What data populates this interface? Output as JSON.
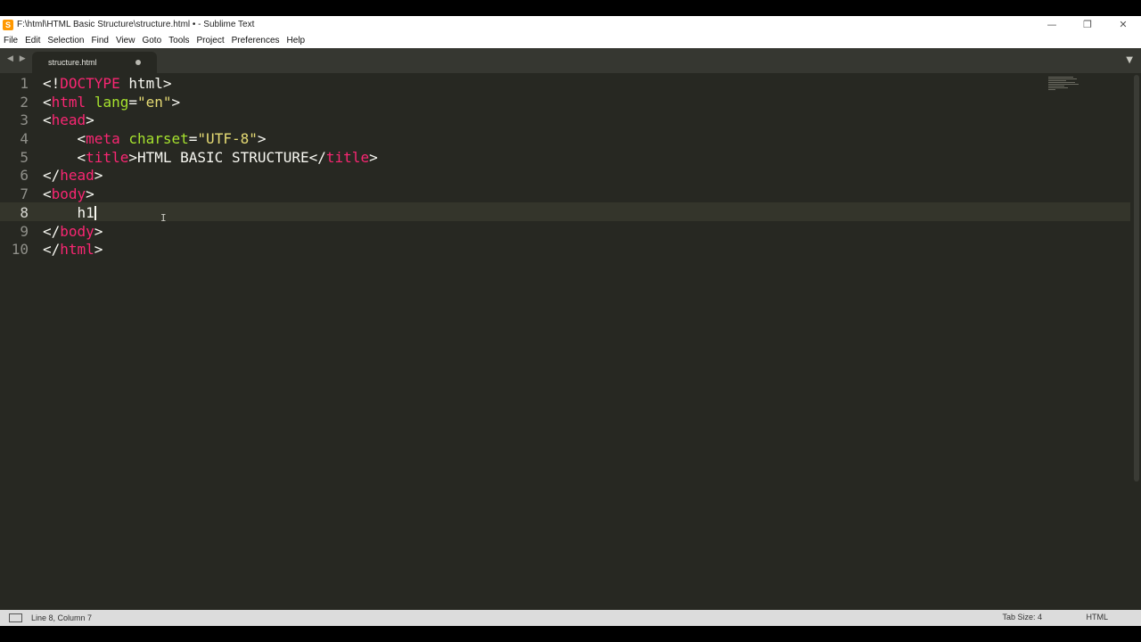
{
  "window": {
    "title": "F:\\html\\HTML Basic Structure\\structure.html • - Sublime Text",
    "controls": {
      "minimize": "—",
      "restore": "❐",
      "close": "✕"
    }
  },
  "menu": {
    "items": [
      "File",
      "Edit",
      "Selection",
      "Find",
      "View",
      "Goto",
      "Tools",
      "Project",
      "Preferences",
      "Help"
    ]
  },
  "tabbar": {
    "nav_arrows": "◀ ▶",
    "tab_label": "structure.html",
    "dropdown": "▼"
  },
  "editor": {
    "line_numbers": [
      "1",
      "2",
      "3",
      "4",
      "5",
      "6",
      "7",
      "8",
      "9",
      "10"
    ],
    "active_line": 8,
    "lines": [
      [
        {
          "t": "<!",
          "c": ""
        },
        {
          "t": "DOCTYPE",
          "c": "tg"
        },
        {
          "t": " html>",
          "c": ""
        }
      ],
      [
        {
          "t": "<",
          "c": ""
        },
        {
          "t": "html",
          "c": "tg"
        },
        {
          "t": " ",
          "c": ""
        },
        {
          "t": "lang",
          "c": "at"
        },
        {
          "t": "=",
          "c": ""
        },
        {
          "t": "\"en\"",
          "c": "st"
        },
        {
          "t": ">",
          "c": ""
        }
      ],
      [
        {
          "t": "<",
          "c": ""
        },
        {
          "t": "head",
          "c": "tg"
        },
        {
          "t": ">",
          "c": ""
        }
      ],
      [
        {
          "t": "    <",
          "c": ""
        },
        {
          "t": "meta",
          "c": "tg"
        },
        {
          "t": " ",
          "c": ""
        },
        {
          "t": "charset",
          "c": "at"
        },
        {
          "t": "=",
          "c": ""
        },
        {
          "t": "\"UTF-8\"",
          "c": "st"
        },
        {
          "t": ">",
          "c": ""
        }
      ],
      [
        {
          "t": "    <",
          "c": ""
        },
        {
          "t": "title",
          "c": "tg"
        },
        {
          "t": ">HTML BASIC STRUCTURE</",
          "c": ""
        },
        {
          "t": "title",
          "c": "tg"
        },
        {
          "t": ">",
          "c": ""
        }
      ],
      [
        {
          "t": "</",
          "c": ""
        },
        {
          "t": "head",
          "c": "tg"
        },
        {
          "t": ">",
          "c": ""
        }
      ],
      [
        {
          "t": "<",
          "c": ""
        },
        {
          "t": "body",
          "c": "tg"
        },
        {
          "t": ">",
          "c": ""
        }
      ],
      [
        {
          "t": "    h1",
          "c": ""
        }
      ],
      [
        {
          "t": "</",
          "c": ""
        },
        {
          "t": "body",
          "c": "tg"
        },
        {
          "t": ">",
          "c": ""
        }
      ],
      [
        {
          "t": "</",
          "c": ""
        },
        {
          "t": "html",
          "c": "tg"
        },
        {
          "t": ">",
          "c": ""
        }
      ]
    ]
  },
  "status": {
    "position": "Line 8, Column 7",
    "tab_size": "Tab Size: 4",
    "syntax": "HTML"
  },
  "colors": {
    "editor_bg": "#272822",
    "tag": "#f92672",
    "attribute": "#a6e22e",
    "string": "#e6db74",
    "text": "#f8f8f2"
  }
}
